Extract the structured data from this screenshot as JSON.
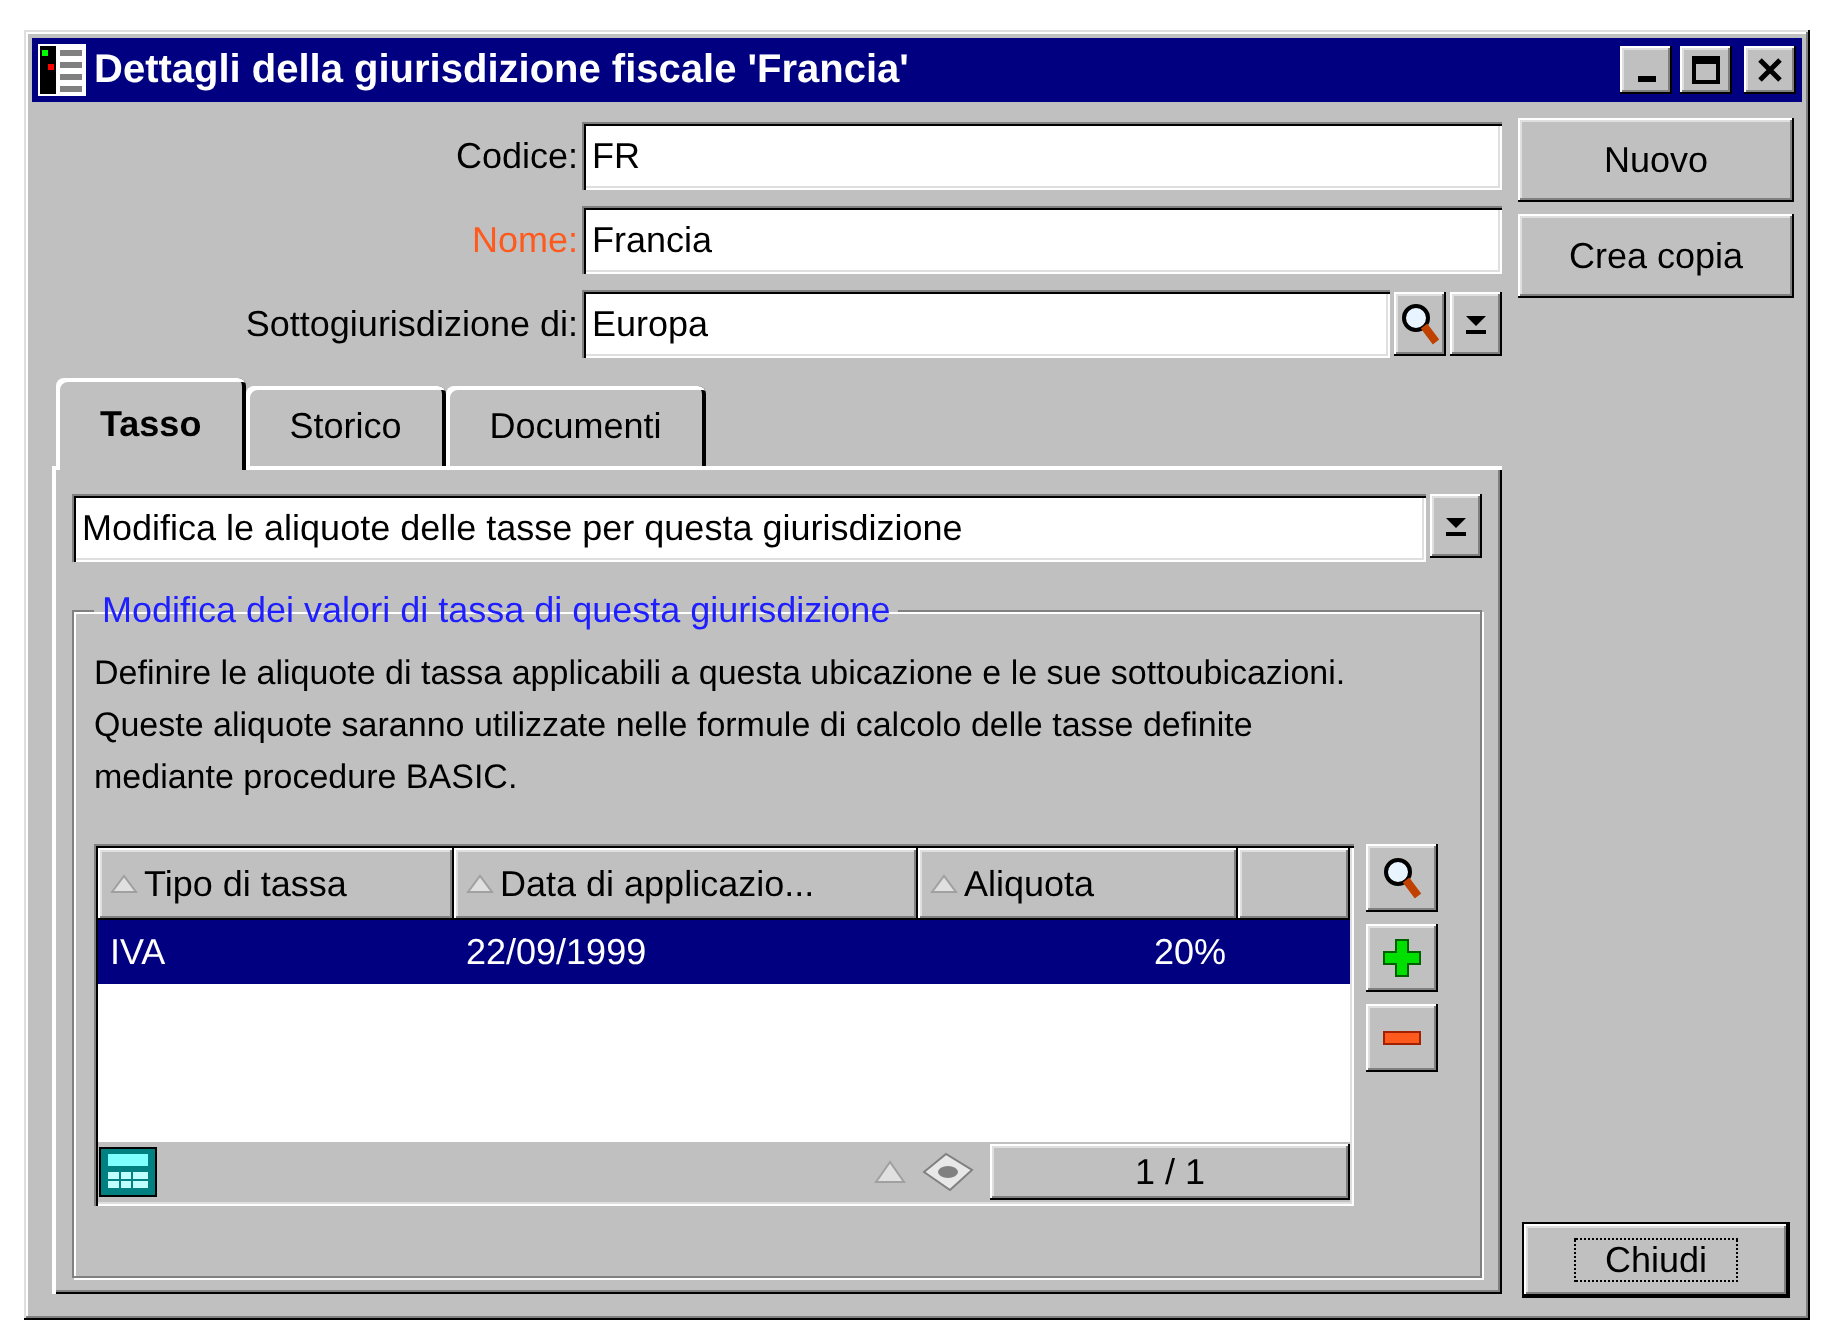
{
  "window": {
    "title": "Dettagli della giurisdizione fiscale 'Francia'"
  },
  "fields": [
    {
      "label": "Codice:",
      "value": "FR",
      "required": false,
      "kind": "text"
    },
    {
      "label": "Nome:",
      "value": "Francia",
      "required": true,
      "kind": "text"
    },
    {
      "label": "Sottogiurisdizione di:",
      "value": "Europa",
      "required": false,
      "kind": "lookup"
    }
  ],
  "buttons": [
    "Nuovo",
    "Crea copia"
  ],
  "tabs": [
    {
      "label": "Tasso",
      "selected": true
    },
    {
      "label": "Storico",
      "selected": false
    },
    {
      "label": "Documenti",
      "selected": false
    }
  ],
  "action_select": {
    "value": "Modifica le aliquote delle tasse per questa giurisdizione"
  },
  "group": {
    "title": "Modifica dei valori di tassa di questa giurisdizione",
    "description": "Definire le aliquote di tassa applicabili a questa ubicazione e le sue sottoubicazioni. Queste aliquote saranno utilizzate nelle formule di calcolo delle tasse definite mediante procedure BASIC."
  },
  "table": {
    "columns": [
      "Tipo di tassa",
      "Data di applicazio...",
      "Aliquota"
    ],
    "rows": [
      {
        "cells": [
          "IVA",
          "22/09/1999",
          "20%"
        ],
        "selected": true
      }
    ],
    "pager": "1 / 1"
  },
  "close_button": "Chiudi"
}
